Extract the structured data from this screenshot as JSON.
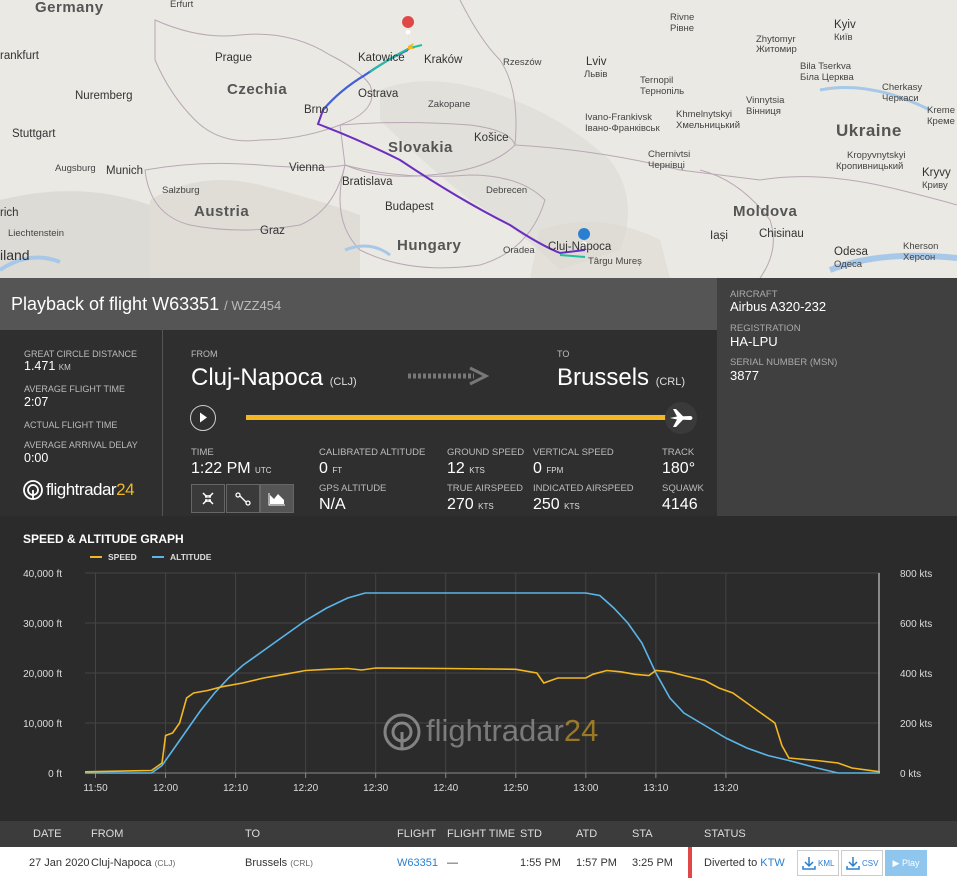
{
  "map": {
    "countries": [
      "Germany",
      "Czechia",
      "Slovakia",
      "Austria",
      "Hungary",
      "Ukraine",
      "Moldova"
    ],
    "cities": [
      {
        "name": "Prague"
      },
      {
        "name": "Nuremberg"
      },
      {
        "name": "Stuttgart"
      },
      {
        "name": "Munich"
      },
      {
        "name": "Augsburg"
      },
      {
        "name": "Salzburg"
      },
      {
        "name": "Vienna"
      },
      {
        "name": "Bratislava"
      },
      {
        "name": "Brno"
      },
      {
        "name": "Ostrava"
      },
      {
        "name": "Katowice"
      },
      {
        "name": "Kraków"
      },
      {
        "name": "Rzeszów"
      },
      {
        "name": "Lviv"
      },
      {
        "name": "Львів"
      },
      {
        "name": "Košice"
      },
      {
        "name": "Debrecen"
      },
      {
        "name": "Budapest"
      },
      {
        "name": "Graz"
      },
      {
        "name": "Liechtenstein"
      },
      {
        "name": "Cluj-Napoca"
      },
      {
        "name": "Oradea"
      },
      {
        "name": "Târgu Mureș"
      },
      {
        "name": "Iași"
      },
      {
        "name": "Chisinau"
      },
      {
        "name": "Odesa"
      },
      {
        "name": "Одеса"
      },
      {
        "name": "Kyiv"
      },
      {
        "name": "Київ"
      },
      {
        "name": "Zhytomyr"
      },
      {
        "name": "Житомир"
      },
      {
        "name": "Rivne"
      },
      {
        "name": "Рівне"
      },
      {
        "name": "Ternopil"
      },
      {
        "name": "Тернопіль"
      },
      {
        "name": "Khmelnytskyi"
      },
      {
        "name": "Хмельницький"
      },
      {
        "name": "Ivano-Frankivsk"
      },
      {
        "name": "Івано-Франківськ"
      },
      {
        "name": "Chernivtsi"
      },
      {
        "name": "Чернівці"
      },
      {
        "name": "Vinnytsia"
      },
      {
        "name": "Вінниця"
      },
      {
        "name": "Bila Tserkva"
      },
      {
        "name": "Біла Церква"
      },
      {
        "name": "Cherkasy"
      },
      {
        "name": "Черкаси"
      },
      {
        "name": "Kropyvnytskyi"
      },
      {
        "name": "Кропивницький"
      },
      {
        "name": "Kryvy"
      },
      {
        "name": "Криву"
      },
      {
        "name": "Khmelnytskyi2"
      },
      {
        "name": "Kherson"
      },
      {
        "name": "Херсон"
      },
      {
        "name": "Kreme"
      },
      {
        "name": "Креме"
      },
      {
        "name": "Zakopane"
      },
      {
        "name": "Erfurt"
      },
      {
        "name": "rankfurt"
      },
      {
        "name": "iland"
      },
      {
        "name": "rich"
      }
    ]
  },
  "header": {
    "title": "Playback of flight W63351",
    "callsign": "/ WZZ454",
    "close_icon": "×"
  },
  "aircraft": {
    "aircraft_label": "AIRCRAFT",
    "aircraft_value": "Airbus A320-232",
    "registration_label": "REGISTRATION",
    "registration_value": "HA-LPU",
    "serial_label": "SERIAL NUMBER (MSN)",
    "serial_value": "3877"
  },
  "stats": {
    "gcd_label": "GREAT CIRCLE DISTANCE",
    "gcd_value": "1.471",
    "gcd_unit": "KM",
    "aft_label": "AVERAGE FLIGHT TIME",
    "aft_value": "2:07",
    "actual_label": "ACTUAL FLIGHT TIME",
    "aad_label": "AVERAGE ARRIVAL DELAY",
    "aad_value": "0:00",
    "logo_main": "flightradar",
    "logo_num": "24"
  },
  "route": {
    "from_label": "FROM",
    "from_city": "Cluj-Napoca",
    "from_code": "(CLJ)",
    "to_label": "TO",
    "to_city": "Brussels",
    "to_code": "(CRL)",
    "progress": 0.98
  },
  "flight": {
    "time_label": "TIME",
    "time_value": "1:22 PM",
    "time_unit": "UTC",
    "calt_label": "CALIBRATED ALTITUDE",
    "calt_value": "0",
    "calt_unit": "FT",
    "gps_label": "GPS ALTITUDE",
    "gps_value": "N/A",
    "gs_label": "GROUND SPEED",
    "gs_value": "12",
    "gs_unit": "KTS",
    "tas_label": "TRUE AIRSPEED",
    "tas_value": "270",
    "tas_unit": "KTS",
    "vs_label": "VERTICAL SPEED",
    "vs_value": "0",
    "vs_unit": "FPM",
    "ias_label": "INDICATED AIRSPEED",
    "ias_value": "250",
    "ias_unit": "KTS",
    "track_label": "TRACK",
    "track_value": "180°",
    "squawk_label": "SQUAWK",
    "squawk_value": "4146"
  },
  "graph": {
    "title": "SPEED & ALTITUDE GRAPH",
    "legend_speed": "SPEED",
    "legend_altitude": "ALTITUDE",
    "logo_main": "flightradar",
    "logo_num": "24"
  },
  "chart_data": {
    "type": "line",
    "title": "SPEED & ALTITUDE GRAPH",
    "x_ticks": [
      "11:50",
      "12:00",
      "12:10",
      "12:20",
      "12:30",
      "12:40",
      "12:50",
      "13:00",
      "13:10",
      "13:20"
    ],
    "y_left_ticks": [
      "0 ft",
      "10,000 ft",
      "20,000 ft",
      "30,000 ft",
      "40,000 ft"
    ],
    "y_right_ticks": [
      "0 kts",
      "200 kts",
      "400 kts",
      "600 kts",
      "800 kts"
    ],
    "ylim_left": [
      0,
      40000
    ],
    "ylim_right": [
      0,
      800
    ],
    "x_unit": "minutes after 11:50",
    "xlim": [
      -1.5,
      92
    ],
    "legend_position": "top-left",
    "grid": true,
    "colors": {
      "speed": "#f2b722",
      "altitude": "#5bb5e8"
    },
    "series": [
      {
        "name": "ALTITUDE",
        "axis": "left",
        "points": [
          [
            -1.5,
            0
          ],
          [
            8,
            0
          ],
          [
            9.5,
            1500
          ],
          [
            11,
            4500
          ],
          [
            13,
            8500
          ],
          [
            15,
            12500
          ],
          [
            17,
            16000
          ],
          [
            19,
            19000
          ],
          [
            21,
            21500
          ],
          [
            24,
            24500
          ],
          [
            27,
            27500
          ],
          [
            30,
            30500
          ],
          [
            33,
            33000
          ],
          [
            36,
            35000
          ],
          [
            38.5,
            36000
          ],
          [
            48,
            36000
          ],
          [
            60,
            36000
          ],
          [
            70,
            36000
          ],
          [
            72,
            35500
          ],
          [
            74,
            33000
          ],
          [
            76,
            30000
          ],
          [
            78,
            26000
          ],
          [
            80,
            20000
          ],
          [
            82,
            15000
          ],
          [
            84,
            12000
          ],
          [
            87,
            9500
          ],
          [
            90,
            7000
          ],
          [
            93,
            5000
          ],
          [
            96,
            3500
          ],
          [
            99,
            2500
          ],
          [
            103,
            1000
          ],
          [
            106,
            0
          ],
          [
            112,
            0
          ]
        ]
      },
      {
        "name": "SPEED",
        "axis": "right",
        "points": [
          [
            -1.5,
            5
          ],
          [
            8,
            10
          ],
          [
            9.5,
            40
          ],
          [
            10,
            150
          ],
          [
            11,
            160
          ],
          [
            12,
            200
          ],
          [
            13,
            300
          ],
          [
            14,
            320
          ],
          [
            16,
            330
          ],
          [
            18,
            345
          ],
          [
            21,
            360
          ],
          [
            24,
            380
          ],
          [
            27,
            395
          ],
          [
            30,
            410
          ],
          [
            33,
            415
          ],
          [
            36,
            418
          ],
          [
            38,
            412
          ],
          [
            40,
            420
          ],
          [
            50,
            418
          ],
          [
            60,
            415
          ],
          [
            63,
            400
          ],
          [
            64,
            360
          ],
          [
            65,
            370
          ],
          [
            66,
            380
          ],
          [
            70,
            380
          ],
          [
            71,
            395
          ],
          [
            73,
            410
          ],
          [
            75,
            405
          ],
          [
            77,
            395
          ],
          [
            79,
            390
          ],
          [
            80,
            410
          ],
          [
            82,
            405
          ],
          [
            84,
            390
          ],
          [
            87,
            370
          ],
          [
            89,
            340
          ],
          [
            91,
            320
          ],
          [
            93,
            280
          ],
          [
            95,
            240
          ],
          [
            97,
            200
          ],
          [
            98,
            110
          ],
          [
            99,
            60
          ],
          [
            103,
            50
          ],
          [
            106,
            40
          ],
          [
            108,
            20
          ],
          [
            112,
            5
          ]
        ]
      }
    ]
  },
  "table": {
    "headers": [
      "DATE",
      "FROM",
      "TO",
      "FLIGHT",
      "FLIGHT TIME",
      "STD",
      "ATD",
      "STA",
      "STATUS"
    ],
    "row": {
      "date": "27 Jan 2020",
      "from": "Cluj-Napoca",
      "from_code": "(CLJ)",
      "to": "Brussels",
      "to_code": "(CRL)",
      "flight": "W63351",
      "flight_time": "—",
      "std": "1:55 PM",
      "atd": "1:57 PM",
      "sta": "3:25 PM",
      "status": "Diverted to",
      "status_link": "KTW",
      "kml": "KML",
      "csv": "CSV",
      "play": "▶ Play"
    }
  }
}
